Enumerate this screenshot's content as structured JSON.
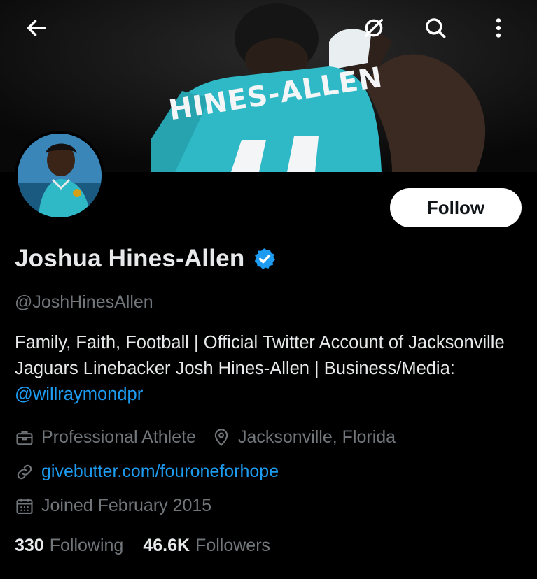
{
  "banner": {
    "jersey_name": "HINES-ALLEN",
    "jersey_color": "#2fb8c6"
  },
  "header": {
    "back_icon": "arrow-left-icon",
    "grok_icon": "slash-circle-icon",
    "search_icon": "search-icon",
    "more_icon": "more-vertical-icon"
  },
  "profile": {
    "display_name": "Joshua Hines-Allen",
    "handle": "@JoshHinesAllen",
    "verified_color": "#1d9bf0",
    "follow_label": "Follow",
    "bio_text": "Family, Faith, Football | Official Twitter Account of Jacksonville Jaguars Linebacker Josh Hines-Allen | Business/Media: ",
    "bio_mention": "@willraymondpr",
    "profession": "Professional Athlete",
    "location": "Jacksonville, Florida",
    "website": "givebutter.com/fouroneforhope",
    "joined": "Joined February 2015",
    "following_count": "330",
    "following_label": "Following",
    "followers_count": "46.6K",
    "followers_label": "Followers"
  },
  "colors": {
    "background": "#000000",
    "text_primary": "#e7e9ea",
    "text_secondary": "#71767b",
    "link": "#1d9bf0"
  }
}
